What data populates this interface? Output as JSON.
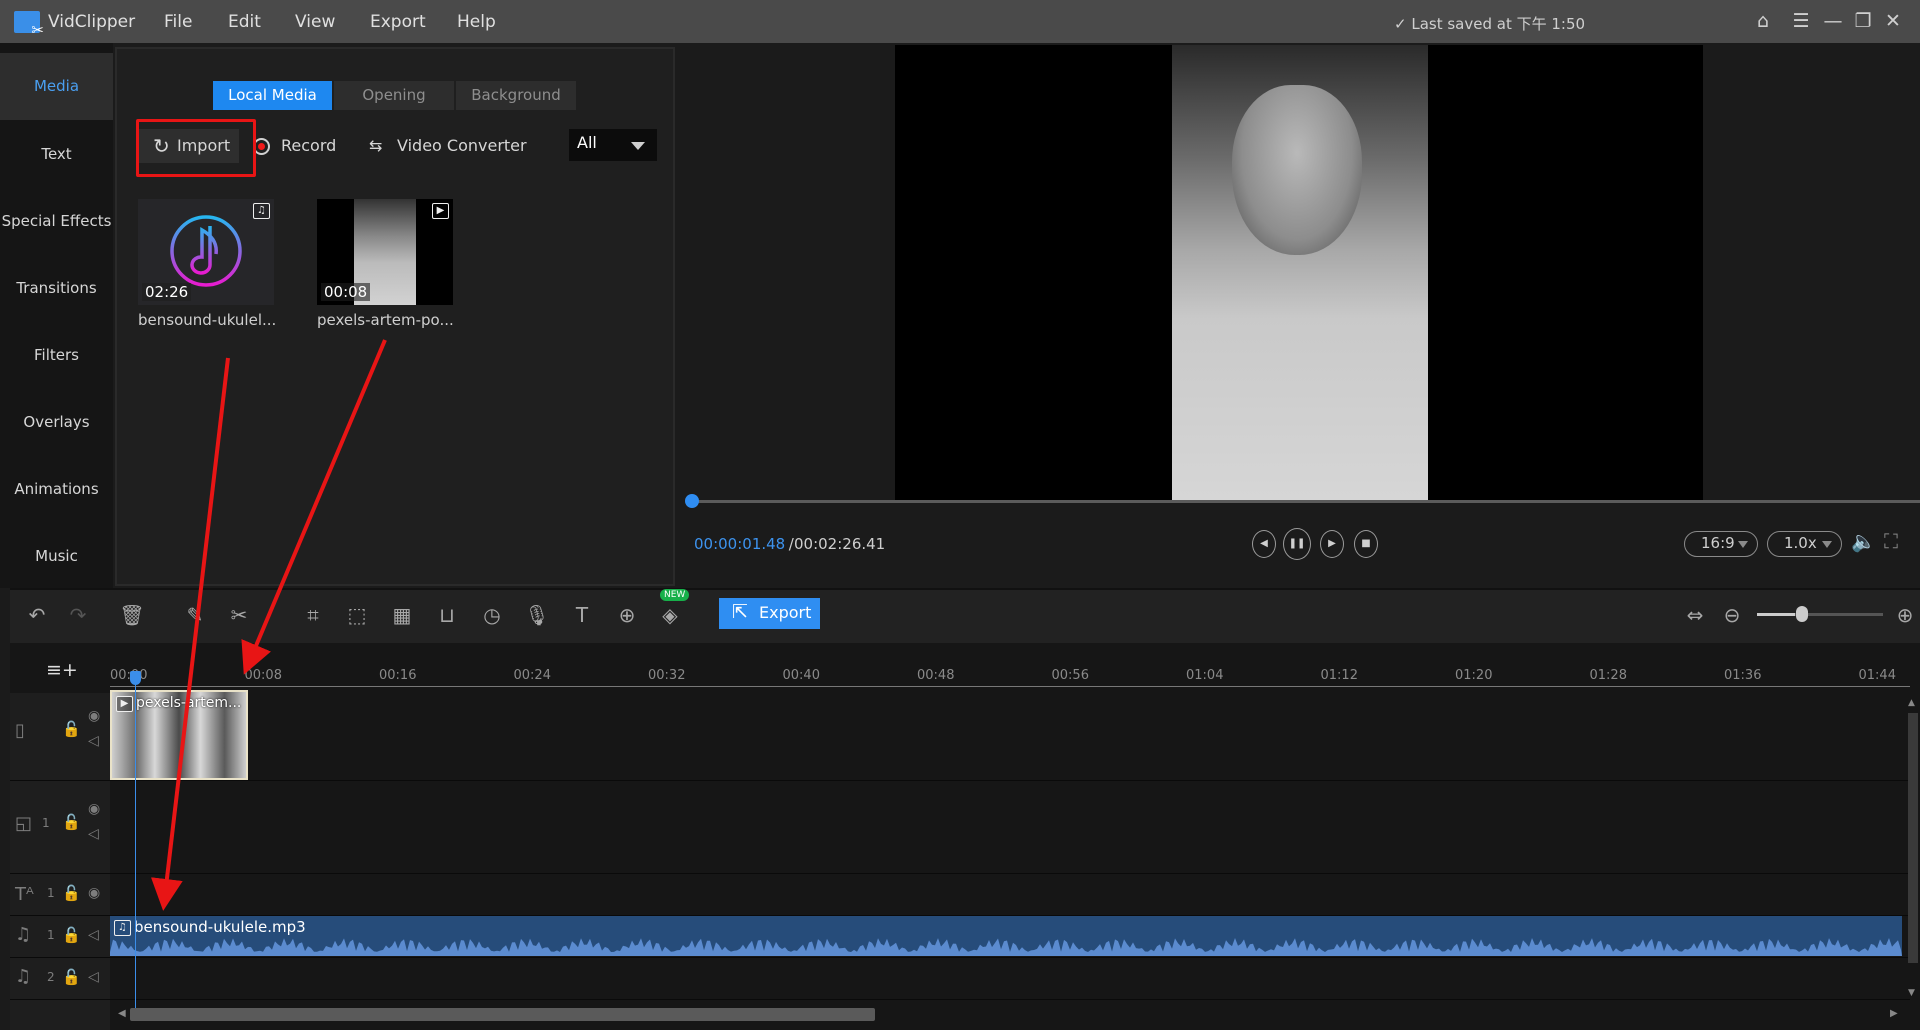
{
  "titlebar": {
    "app_name": "VidClipper",
    "menu": [
      "File",
      "Edit",
      "View",
      "Export",
      "Help"
    ],
    "saved_status": "✓ Last saved at 下午 1:50",
    "icons": {
      "home": "⌂",
      "menu": "☰",
      "minimize": "—",
      "maximize": "❐",
      "close": "✕"
    }
  },
  "leftnav": {
    "items": [
      {
        "label": "Media",
        "active": true
      },
      {
        "label": "Text"
      },
      {
        "label": "Special Effects"
      },
      {
        "label": "Transitions"
      },
      {
        "label": "Filters"
      },
      {
        "label": "Overlays"
      },
      {
        "label": "Animations"
      },
      {
        "label": "Music"
      }
    ]
  },
  "media": {
    "tabs": [
      "Local Media",
      "Opening",
      "Background"
    ],
    "active_tab": "Local Media",
    "import_label": "Import",
    "record_label": "Record",
    "converter_label": "Video Converter",
    "filter_value": "All",
    "items": [
      {
        "name": "bensound-ukulel...",
        "duration": "02:26",
        "type": "audio",
        "badge": "♫"
      },
      {
        "name": "pexels-artem-po...",
        "duration": "00:08",
        "type": "video",
        "badge": "▶"
      }
    ]
  },
  "preview": {
    "current_time": "00:00:01.48",
    "separator": " / ",
    "total_time": "00:02:26.41",
    "playback_progress_percent": 1,
    "aspect_ratio": "16:9",
    "speed": "1.0x",
    "controls": {
      "prev": "◀",
      "pause": "❚❚",
      "next": "▶",
      "stop": "■"
    },
    "icons": {
      "volume": "🔈",
      "fullscreen": "⛶"
    }
  },
  "toolbar": {
    "export_label": "Export",
    "new_badge": "NEW",
    "zoom_level_percent": 30,
    "icons": {
      "undo": "↶",
      "redo": "↷",
      "delete": "🗑",
      "edit": "✎",
      "cut": "✂",
      "crop": "⌗",
      "resize": "⬚",
      "mosaic": "▦",
      "freeze": "⊔",
      "speed": "◷",
      "record_voice": "🎙",
      "text_to_speech": "T",
      "speech_to_text": "⊕",
      "sticker": "◈",
      "fit": "⇔",
      "zoom_out": "⊖",
      "zoom_in": "⊕"
    }
  },
  "timeline": {
    "ruler_ticks": [
      "00:00",
      "00:08",
      "00:16",
      "00:24",
      "00:32",
      "00:40",
      "00:48",
      "00:56",
      "01:04",
      "01:12",
      "01:20",
      "01:28",
      "01:36",
      "01:44"
    ],
    "add_track_icon": "≡+",
    "tracks": [
      {
        "type": "video",
        "number": "",
        "icons": [
          "film",
          "lock",
          "eye",
          "speaker"
        ]
      },
      {
        "type": "pip",
        "number": "1",
        "icons": [
          "pip",
          "lock",
          "eye",
          "speaker"
        ]
      },
      {
        "type": "text",
        "number": "1",
        "icons": [
          "text",
          "lock",
          "eye"
        ]
      },
      {
        "type": "music",
        "number": "1",
        "icons": [
          "music",
          "lock",
          "speaker"
        ]
      },
      {
        "type": "music",
        "number": "2",
        "icons": [
          "music",
          "lock",
          "speaker"
        ]
      }
    ],
    "video_clip_label": "pexels-artem...",
    "audio_clip_label": "bensound-ukulele.mp3"
  },
  "colors": {
    "accent": "#2f8ef2",
    "annotation": "#e81515",
    "new_badge": "#17b04a",
    "audio_clip": "#264c7a"
  }
}
